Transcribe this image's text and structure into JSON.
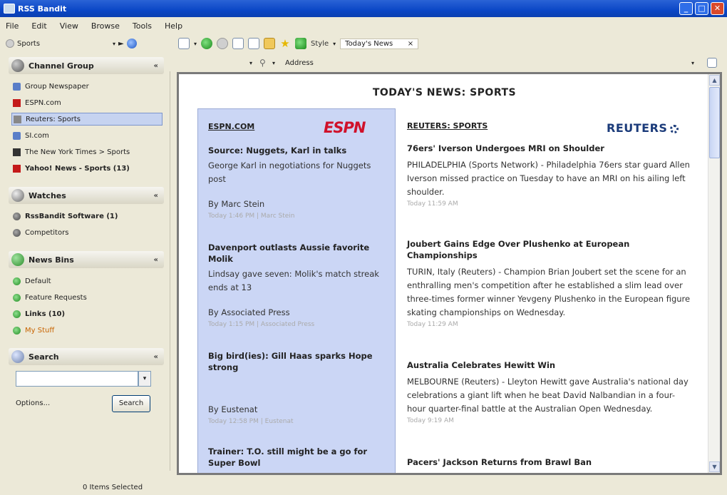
{
  "window": {
    "title": "RSS Bandit"
  },
  "menu": [
    "File",
    "Edit",
    "View",
    "Browse",
    "Tools",
    "Help"
  ],
  "toolbar": {
    "search_text": "Sports",
    "style_label": "Style",
    "tab_label": "Today's News",
    "address_label": "Address"
  },
  "sidebar": {
    "channel_group": {
      "title": "Channel Group",
      "items": [
        {
          "label": "Group Newspaper"
        },
        {
          "label": "ESPN.com"
        },
        {
          "label": "Reuters: Sports"
        },
        {
          "label": "SI.com"
        },
        {
          "label": "The New York Times > Sports"
        },
        {
          "label": "Yahoo! News - Sports (13)"
        }
      ]
    },
    "watches": {
      "title": "Watches",
      "items": [
        {
          "label": "RssBandit Software (1)"
        },
        {
          "label": "Competitors"
        }
      ]
    },
    "news_bins": {
      "title": "News Bins",
      "items": [
        {
          "label": "Default"
        },
        {
          "label": "Feature Requests"
        },
        {
          "label": "Links (10)"
        },
        {
          "label": "My Stuff"
        }
      ]
    },
    "search": {
      "title": "Search",
      "options_label": "Options...",
      "button_label": "Search"
    }
  },
  "page": {
    "title": "TODAY'S NEWS: SPORTS",
    "left": {
      "source": "ESPN.COM",
      "logo": "ESPN",
      "articles": [
        {
          "headline": "Source: Nuggets, Karl in talks",
          "body": "George Karl in negotiations for Nuggets post",
          "byline": "By Marc Stein",
          "meta": "Today 1:46 PM | Marc Stein"
        },
        {
          "headline": "Davenport outlasts Aussie favorite Molik",
          "body": "Lindsay gave seven: Molik's match streak ends at 13",
          "byline": "By Associated Press",
          "meta": "Today 1:15 PM | Associated Press"
        },
        {
          "headline": "Big bird(ies): Gill Haas sparks Hope strong",
          "body": "",
          "byline": "By Eustenat",
          "meta": "Today 12:58 PM | Eustenat"
        },
        {
          "headline": "Trainer: T.O. still might be a go for Super Bowl",
          "body": "",
          "byline": "",
          "meta": ""
        }
      ]
    },
    "right": {
      "source": "REUTERS: SPORTS",
      "logo": "REUTERS",
      "articles": [
        {
          "headline": "76ers' Iverson Undergoes MRI on Shoulder",
          "body": "PHILADELPHIA (Sports Network) - Philadelphia 76ers star guard Allen Iverson missed practice on Tuesday to have an MRI on his ailing left shoulder.",
          "meta": "Today 11:59 AM"
        },
        {
          "headline": "Joubert Gains Edge Over Plushenko at European Championships",
          "body": "TURIN, Italy (Reuters) - Champion Brian Joubert set the scene for an enthralling men's competition after he established a slim lead over three-times former winner Yevgeny Plushenko in the European figure skating championships on Wednesday.",
          "meta": "Today 11:29 AM"
        },
        {
          "headline": "Australia Celebrates Hewitt Win",
          "body": "MELBOURNE (Reuters) - Lleyton Hewitt gave Australia's national day celebrations a giant lift when he beat David Nalbandian in a four-hour quarter-final battle at the Australian Open Wednesday.",
          "meta": "Today 9:19 AM"
        },
        {
          "headline": "Pacers' Jackson Returns from Brawl Ban",
          "body": "",
          "meta": ""
        }
      ]
    }
  },
  "status": {
    "text": "0 Items Selected"
  }
}
